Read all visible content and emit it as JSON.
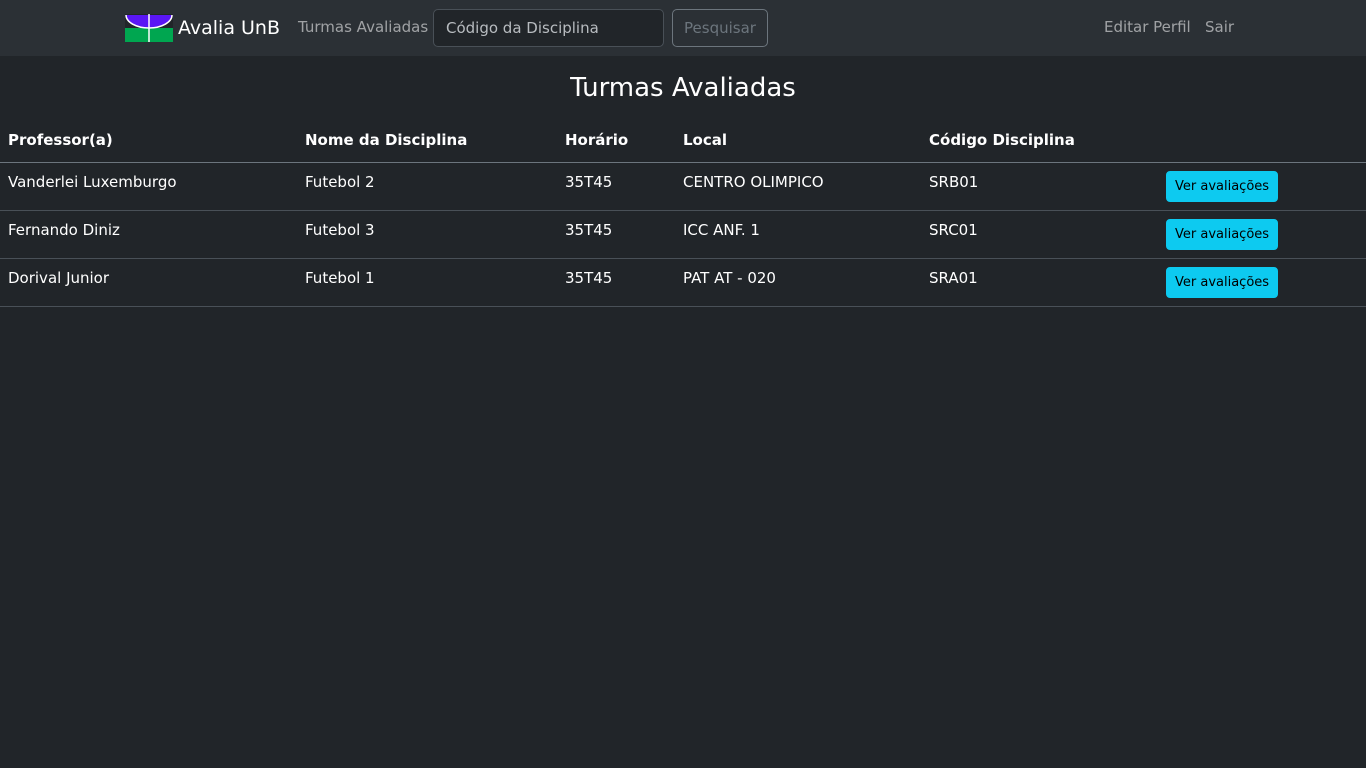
{
  "navbar": {
    "brand": "Avalia UnB",
    "turmas_link": "Turmas Avaliadas",
    "search_placeholder": "Código da Disciplina",
    "search_value": "",
    "search_button": "Pesquisar",
    "editar_perfil": "Editar Perfil",
    "sair": "Sair"
  },
  "page": {
    "title": "Turmas Avaliadas"
  },
  "table": {
    "headers": [
      "Professor(a)",
      "Nome da Disciplina",
      "Horário",
      "Local",
      "Código Disciplina",
      ""
    ],
    "action_label": "Ver avaliações",
    "rows": [
      {
        "professor": "Vanderlei Luxemburgo",
        "disciplina": "Futebol 2",
        "horario": "35T45",
        "local": "CENTRO OLIMPICO",
        "codigo": "SRB01"
      },
      {
        "professor": "Fernando Diniz",
        "disciplina": "Futebol 3",
        "horario": "35T45",
        "local": "ICC ANF. 1",
        "codigo": "SRC01"
      },
      {
        "professor": "Dorival Junior",
        "disciplina": "Futebol 1",
        "horario": "35T45",
        "local": "PAT AT - 020",
        "codigo": "SRA01"
      }
    ]
  },
  "colors": {
    "background": "#212529",
    "navbar": "#2b3035",
    "info_button": "#0dcaf0",
    "logo_purple": "#5a16f5",
    "logo_green": "#00a650"
  },
  "icons": {
    "brand_logo": "unb-logo-icon"
  }
}
